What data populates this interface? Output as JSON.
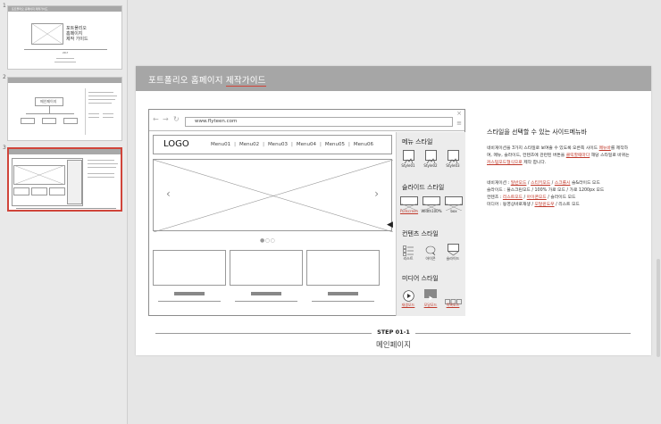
{
  "slides": [
    {
      "num": "1",
      "title": "포트폴리오 홈페이지 제작가이드",
      "lines": [
        "포트폴리오",
        "홈페이지",
        "제작 가이드"
      ],
      "footer": "2017"
    },
    {
      "num": "2",
      "box_label": "메인페이지"
    },
    {
      "num": "3"
    }
  ],
  "slide": {
    "title_prefix": "포트폴리오 홈페이지 ",
    "title_underlined": "제작가이드",
    "browser": {
      "url": "www.flyteen.com",
      "close": "×",
      "menu": "≡",
      "back": "←",
      "forward": "→",
      "refresh": "↻"
    },
    "site": {
      "logo": "LOGO",
      "menu": [
        "Menu01",
        "Menu02",
        "Menu03",
        "Menu04",
        "Menu05",
        "Menu06"
      ],
      "prev": "‹",
      "next": "›",
      "dots": "●○○",
      "toggle": "◀"
    },
    "panel": {
      "menu_style": {
        "title": "메뉴 스타일",
        "items": [
          "Style01",
          "Style02",
          "Style03"
        ]
      },
      "slide_style": {
        "title": "슬라이드 스타일",
        "items": [
          "Fullscreen",
          "Width100%",
          "box"
        ]
      },
      "content_style": {
        "title": "컨텐츠 스타일",
        "items": [
          "리스트",
          "아이콘",
          "슬라이드"
        ]
      },
      "media_style": {
        "title": "미디어 스타일",
        "items": [
          "재생모드",
          "모달모드",
          "목록모드"
        ]
      }
    },
    "description": {
      "title": "스타일을 선택할 수 있는 사이드메뉴바",
      "para1_a": "네비게이션을 3가지 스타일로 보여줄 수 있도록 오른쪽 사이드 ",
      "para1_b": "메뉴바",
      "para1_c": "를 제작하여, 메뉴, 슬라이드, 컨텐츠에 관련된 버튼을 ",
      "para1_d": "클릭할때마다",
      "para1_e": " 해당 스타일로 바뀌는 ",
      "para1_f": "커스텀모드형식으로",
      "para1_g": " 제작 합니다.",
      "nav_label": "네비게이션 : ",
      "nav_a": "일반모드",
      "nav_b": "스티키모드",
      "nav_c": "스크롤시",
      "nav_d": " 슬&라이드 모드",
      "slide_line": "슬라이드 : 풀스크린모드 / 100% 가로 모드 / 가로 1200px 모드",
      "content_label": "컨텐츠 : ",
      "content_a": "리스트모드",
      "content_b": "아이콘모드",
      "content_c": " / 슬라이드 모드",
      "media_label": "미디어 : 동영상바로재생 / ",
      "media_a": "모달윈도우",
      "media_b": " / 리스트 모드"
    },
    "step": {
      "label": "STEP 01-1",
      "sub": "메인페이지"
    }
  }
}
